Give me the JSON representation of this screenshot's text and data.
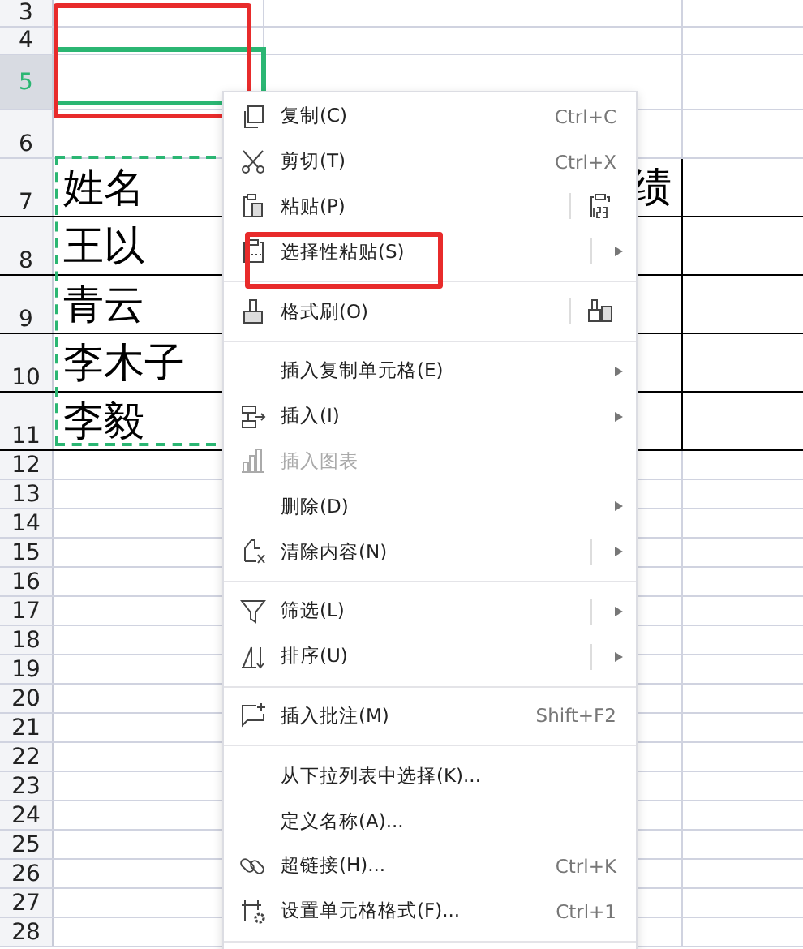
{
  "sheet": {
    "rows": [
      {
        "header": "3",
        "selected": false,
        "cells": []
      },
      {
        "header": "4",
        "selected": false,
        "cells": []
      },
      {
        "header": "5",
        "selected": true,
        "cells": []
      },
      {
        "header": "6",
        "selected": false,
        "cells": []
      },
      {
        "header": "7",
        "selected": false,
        "cells": [
          "姓名",
          "绩"
        ]
      },
      {
        "header": "8",
        "selected": false,
        "cells": [
          "王以"
        ]
      },
      {
        "header": "9",
        "selected": false,
        "cells": [
          "青云"
        ]
      },
      {
        "header": "10",
        "selected": false,
        "cells": [
          "李木子"
        ]
      },
      {
        "header": "11",
        "selected": false,
        "cells": [
          "李毅"
        ]
      },
      {
        "header": "12",
        "selected": false,
        "cells": []
      },
      {
        "header": "13",
        "selected": false,
        "cells": []
      },
      {
        "header": "14",
        "selected": false,
        "cells": []
      },
      {
        "header": "15",
        "selected": false,
        "cells": []
      },
      {
        "header": "16",
        "selected": false,
        "cells": []
      },
      {
        "header": "17",
        "selected": false,
        "cells": []
      },
      {
        "header": "18",
        "selected": false,
        "cells": []
      },
      {
        "header": "19",
        "selected": false,
        "cells": []
      },
      {
        "header": "20",
        "selected": false,
        "cells": []
      },
      {
        "header": "21",
        "selected": false,
        "cells": []
      },
      {
        "header": "22",
        "selected": false,
        "cells": []
      },
      {
        "header": "23",
        "selected": false,
        "cells": []
      },
      {
        "header": "24",
        "selected": false,
        "cells": []
      },
      {
        "header": "25",
        "selected": false,
        "cells": []
      },
      {
        "header": "26",
        "selected": false,
        "cells": []
      },
      {
        "header": "27",
        "selected": false,
        "cells": []
      },
      {
        "header": "28",
        "selected": false,
        "cells": []
      }
    ]
  },
  "context_menu": {
    "items": [
      {
        "kind": "item",
        "label": "复制(C)",
        "shortcut": "Ctrl+C",
        "submenu": false,
        "disabled": false
      },
      {
        "kind": "item",
        "label": "剪切(T)",
        "shortcut": "Ctrl+X",
        "submenu": false,
        "disabled": false
      },
      {
        "kind": "item",
        "label": "粘贴(P)",
        "split": true,
        "submenu": false,
        "disabled": false
      },
      {
        "kind": "item",
        "label": "选择性粘贴(S)",
        "split": true,
        "submenu": true,
        "disabled": false
      },
      {
        "kind": "separator"
      },
      {
        "kind": "item",
        "label": "格式刷(O)",
        "split": true,
        "submenu": false,
        "disabled": false
      },
      {
        "kind": "separator"
      },
      {
        "kind": "item",
        "label": "插入复制单元格(E)",
        "submenu": true,
        "disabled": false
      },
      {
        "kind": "item",
        "label": "插入(I)",
        "submenu": true,
        "disabled": false
      },
      {
        "kind": "item",
        "label": "插入图表",
        "submenu": false,
        "disabled": true
      },
      {
        "kind": "item",
        "label": "删除(D)",
        "submenu": true,
        "disabled": false
      },
      {
        "kind": "item",
        "label": "清除内容(N)",
        "split": true,
        "submenu": true,
        "disabled": false
      },
      {
        "kind": "separator"
      },
      {
        "kind": "item",
        "label": "筛选(L)",
        "split": true,
        "submenu": true,
        "disabled": false
      },
      {
        "kind": "item",
        "label": "排序(U)",
        "split": true,
        "submenu": true,
        "disabled": false
      },
      {
        "kind": "separator"
      },
      {
        "kind": "item",
        "label": "插入批注(M)",
        "shortcut": "Shift+F2",
        "submenu": false,
        "disabled": false
      },
      {
        "kind": "separator"
      },
      {
        "kind": "item",
        "label": "从下拉列表中选择(K)...",
        "submenu": false,
        "disabled": false
      },
      {
        "kind": "item",
        "label": "定义名称(A)...",
        "submenu": false,
        "disabled": false
      },
      {
        "kind": "item",
        "label": "超链接(H)...",
        "shortcut": "Ctrl+K",
        "submenu": false,
        "disabled": false
      },
      {
        "kind": "item",
        "label": "设置单元格格式(F)...",
        "shortcut": "Ctrl+1",
        "submenu": false,
        "disabled": false
      },
      {
        "kind": "separator"
      }
    ]
  }
}
